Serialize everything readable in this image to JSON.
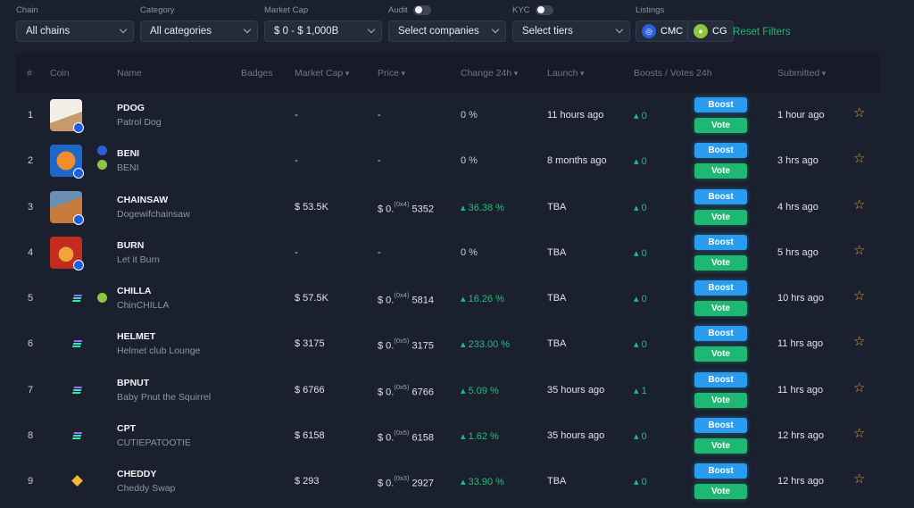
{
  "filters": {
    "chain": {
      "label": "Chain",
      "value": "All chains"
    },
    "category": {
      "label": "Category",
      "value": "All categories"
    },
    "market_cap": {
      "label": "Market Cap",
      "value": "$ 0 - $ 1,000B"
    },
    "audit": {
      "label": "Audit",
      "value": "Select companies"
    },
    "kyc": {
      "label": "KYC",
      "value": "Select tiers"
    },
    "listings": {
      "label": "Listings",
      "cmc": "CMC",
      "cg": "CG"
    },
    "reset": "Reset Filters"
  },
  "columns": {
    "num": "#",
    "coin": "Coin",
    "name": "Name",
    "badges": "Badges",
    "mcap": "Market Cap",
    "price": "Price",
    "change": "Change 24h",
    "launch": "Launch",
    "boosts": "Boosts / Votes 24h",
    "submitted": "Submitted"
  },
  "buttons": {
    "boost": "Boost",
    "vote": "Vote"
  },
  "colors": {
    "accent_green": "#1fbf7f",
    "boost_blue": "#2a9cf0",
    "star": "#e2a02c"
  },
  "rows": [
    {
      "num": "1",
      "symbol": "PDOG",
      "name": "Patrol Dog",
      "mcap": "-",
      "price_prefix": "-",
      "price_zeros": "",
      "price_digits": "",
      "change": "0 %",
      "launch": "11 hours ago",
      "boosts": "0",
      "submitted": "1 hour ago",
      "chain": "sol",
      "listings": []
    },
    {
      "num": "2",
      "symbol": "BENI",
      "name": "BENI",
      "mcap": "-",
      "price_prefix": "-",
      "price_zeros": "",
      "price_digits": "",
      "change": "0 %",
      "launch": "8 months ago",
      "boosts": "0",
      "submitted": "3 hrs ago",
      "chain": "sol",
      "listings": [
        "cmc",
        "cg"
      ]
    },
    {
      "num": "3",
      "symbol": "CHAINSAW",
      "name": "Dogewifchainsaw",
      "mcap": "$ 53.5K",
      "price_prefix": "$ 0.",
      "price_zeros": "(0x4)",
      "price_digits": "5352",
      "change": "36.38 %",
      "launch": "TBA",
      "boosts": "0",
      "submitted": "4 hrs ago",
      "chain": "sol",
      "listings": []
    },
    {
      "num": "4",
      "symbol": "BURN",
      "name": "Let it Burn",
      "mcap": "-",
      "price_prefix": "-",
      "price_zeros": "",
      "price_digits": "",
      "change": "0 %",
      "launch": "TBA",
      "boosts": "0",
      "submitted": "5 hrs ago",
      "chain": "sol",
      "listings": []
    },
    {
      "num": "5",
      "symbol": "CHILLA",
      "name": "ChinCHILLA",
      "mcap": "$ 57.5K",
      "price_prefix": "$ 0.",
      "price_zeros": "(0x4)",
      "price_digits": "5814",
      "change": "16.26 %",
      "launch": "TBA",
      "boosts": "0",
      "submitted": "10 hrs ago",
      "chain": "sol",
      "listings": [
        "cg"
      ]
    },
    {
      "num": "6",
      "symbol": "HELMET",
      "name": "Helmet club Lounge",
      "mcap": "$ 3175",
      "price_prefix": "$ 0.",
      "price_zeros": "(0x5)",
      "price_digits": "3175",
      "change": "233.00 %",
      "launch": "TBA",
      "boosts": "0",
      "submitted": "11 hrs ago",
      "chain": "sol",
      "listings": []
    },
    {
      "num": "7",
      "symbol": "BPNUT",
      "name": "Baby Pnut the Squirrel",
      "mcap": "$ 6766",
      "price_prefix": "$ 0.",
      "price_zeros": "(0x5)",
      "price_digits": "6766",
      "change": "5.09 %",
      "launch": "35 hours ago",
      "boosts": "1",
      "submitted": "11 hrs ago",
      "chain": "sol",
      "listings": []
    },
    {
      "num": "8",
      "symbol": "CPT",
      "name": "CUTIEPATOOTIE",
      "mcap": "$ 6158",
      "price_prefix": "$ 0.",
      "price_zeros": "(0x5)",
      "price_digits": "6158",
      "change": "1.62 %",
      "launch": "35 hours ago",
      "boosts": "0",
      "submitted": "12 hrs ago",
      "chain": "sol",
      "listings": []
    },
    {
      "num": "9",
      "symbol": "CHEDDY",
      "name": "Cheddy Swap",
      "mcap": "$ 293",
      "price_prefix": "$ 0.",
      "price_zeros": "(0x3)",
      "price_digits": "2927",
      "change": "33.90 %",
      "launch": "TBA",
      "boosts": "0",
      "submitted": "12 hrs ago",
      "chain": "bnb",
      "listings": []
    }
  ]
}
